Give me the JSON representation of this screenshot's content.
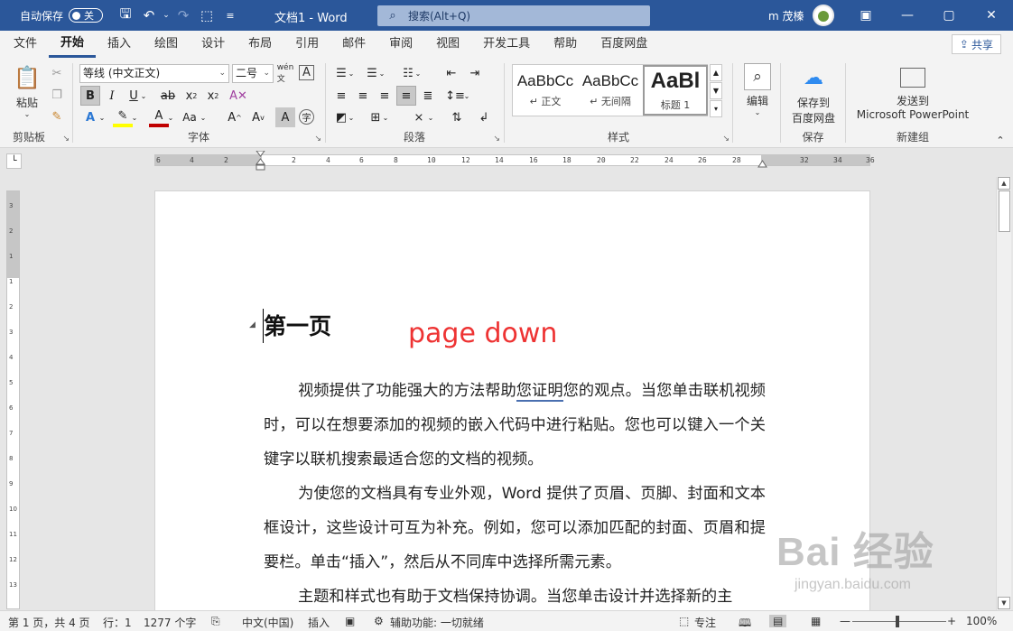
{
  "titlebar": {
    "autosave_label": "自动保存",
    "autosave_state": "关",
    "doc_title": "文档1  -  Word",
    "search_placeholder": "搜索(Alt+Q)",
    "user_name": "m 茂榛"
  },
  "tabs": [
    "文件",
    "开始",
    "插入",
    "绘图",
    "设计",
    "布局",
    "引用",
    "邮件",
    "审阅",
    "视图",
    "开发工具",
    "帮助",
    "百度网盘"
  ],
  "active_tab": "开始",
  "share_label": "共享",
  "ribbon": {
    "clipboard": {
      "paste_label": "粘贴",
      "group_label": "剪贴板"
    },
    "font": {
      "font_name": "等线 (中文正文)",
      "font_size": "二号",
      "group_label": "字体"
    },
    "paragraph": {
      "group_label": "段落"
    },
    "styles": {
      "items": [
        {
          "sample": "AaBbCc",
          "name": "↵ 正文"
        },
        {
          "sample": "AaBbCc",
          "name": "↵ 无间隔"
        },
        {
          "sample": "AaBl",
          "name": "标题 1"
        }
      ],
      "group_label": "样式"
    },
    "editing": {
      "label": "编辑"
    },
    "save": {
      "label_line1": "保存到",
      "label_line2": "百度网盘",
      "group_label": "保存"
    },
    "send": {
      "label_line1": "发送到",
      "label_line2": "Microsoft PowerPoint",
      "group_label": "新建组"
    }
  },
  "ruler": {
    "ticks": [
      "6",
      "4",
      "2",
      "2",
      "4",
      "6",
      "8",
      "10",
      "12",
      "14",
      "16",
      "18",
      "20",
      "22",
      "24",
      "26",
      "28",
      "32",
      "34",
      "36"
    ],
    "vticks": [
      "3",
      "2",
      "1",
      "1",
      "2",
      "3",
      "4",
      "5",
      "6",
      "7",
      "8",
      "9",
      "10",
      "11",
      "12",
      "13"
    ]
  },
  "document": {
    "heading": "第一页",
    "annotation": "page down",
    "paragraphs": [
      {
        "before": "视频提供了功能强大的方法帮助",
        "squiggle": "您证明",
        "after": "您的观点。当您单击联机视频时，可以在想要添加的视频的嵌入代码中进行粘贴。您也可以键入一个关键字以联机搜索最适合您的文档的视频。"
      },
      {
        "before": "为使您的文档具有专业外观，Word 提供了页眉、页脚、封面和文本框设计，这些设计可互为补充。例如，您可以添加匹配的封面、页眉和提要栏。单击“插入”，然后从不同库中选择所需元素。",
        "squiggle": "",
        "after": ""
      },
      {
        "before": "主题和样式也有助于文档保持协调。当您单击设计并选择新的主",
        "squiggle": "",
        "after": ""
      }
    ]
  },
  "statusbar": {
    "page": "第 1 页，共 4 页",
    "line": "行：1",
    "words": "1277 个字",
    "language": "中文(中国)",
    "mode": "插入",
    "accessibility": "辅助功能: 一切就绪",
    "focus": "专注",
    "zoom": "100%"
  },
  "watermark": {
    "main": "Bai 经验",
    "sub": "jingyan.baidu.com"
  }
}
